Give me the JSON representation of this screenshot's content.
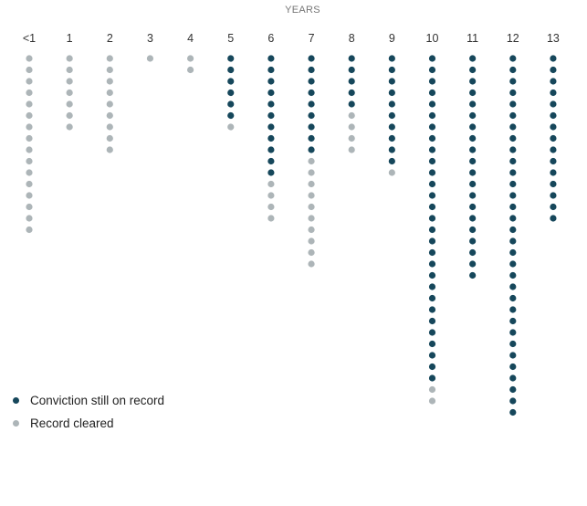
{
  "chart_data": {
    "type": "dot-matrix",
    "xlabel": "YEARS",
    "categories": [
      "<1",
      "1",
      "2",
      "3",
      "4",
      "5",
      "6",
      "7",
      "8",
      "9",
      "10",
      "11",
      "12",
      "13"
    ],
    "series": [
      {
        "name": "Conviction still on record",
        "color": "#16475b",
        "values": [
          0,
          0,
          0,
          0,
          0,
          6,
          11,
          9,
          5,
          10,
          29,
          20,
          32,
          15
        ]
      },
      {
        "name": "Record cleared",
        "color": "#adb5b8",
        "values": [
          16,
          7,
          9,
          1,
          2,
          1,
          4,
          10,
          4,
          1,
          2,
          0,
          0,
          0
        ]
      }
    ],
    "legend_position": "bottom-left"
  }
}
